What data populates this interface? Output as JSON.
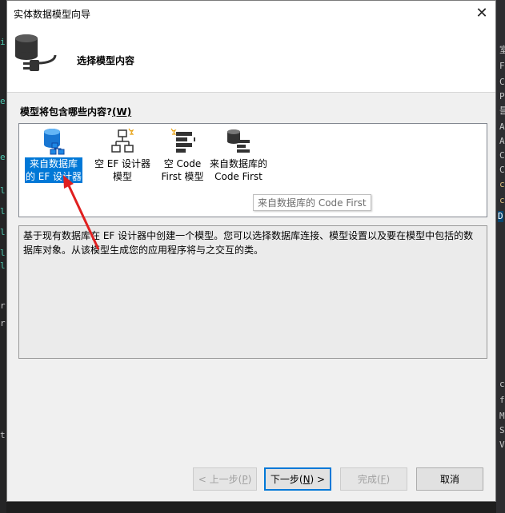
{
  "dialog": {
    "title": "实体数据模型向导",
    "close_symbol": "✕",
    "header_title": "选择模型内容",
    "question": "模型将包含哪些内容?",
    "question_accel": "(W)",
    "items": [
      {
        "label": "来自数据库\n的 EF 设计器",
        "icon": "database-designer-icon",
        "selected": true
      },
      {
        "label": "空 EF 设计器\n模型",
        "icon": "empty-designer-icon",
        "selected": false
      },
      {
        "label": "空 Code\nFirst 模型",
        "icon": "empty-codefirst-icon",
        "selected": false
      },
      {
        "label": "来自数据库的\nCode First",
        "icon": "database-codefirst-icon",
        "selected": false
      }
    ],
    "tooltip": "来自数据库的 Code First",
    "description": "基于现有数据库在 EF 设计器中创建一个模型。您可以选择数据库连接、模型设置以及要在模型中包括的数据库对象。从该模型生成您的应用程序将与之交互的类。",
    "buttons": {
      "back": {
        "label": "< 上一步(",
        "accel": "P",
        "tail": ")"
      },
      "next": {
        "label": "下一步(",
        "accel": "N",
        "tail": ") >"
      },
      "finish": {
        "label": "完成(",
        "accel": "F",
        "tail": ")"
      },
      "cancel": {
        "label": "取消"
      }
    },
    "colors": {
      "selection": "#0078d7",
      "annotation_arrow": "#e02020"
    }
  }
}
